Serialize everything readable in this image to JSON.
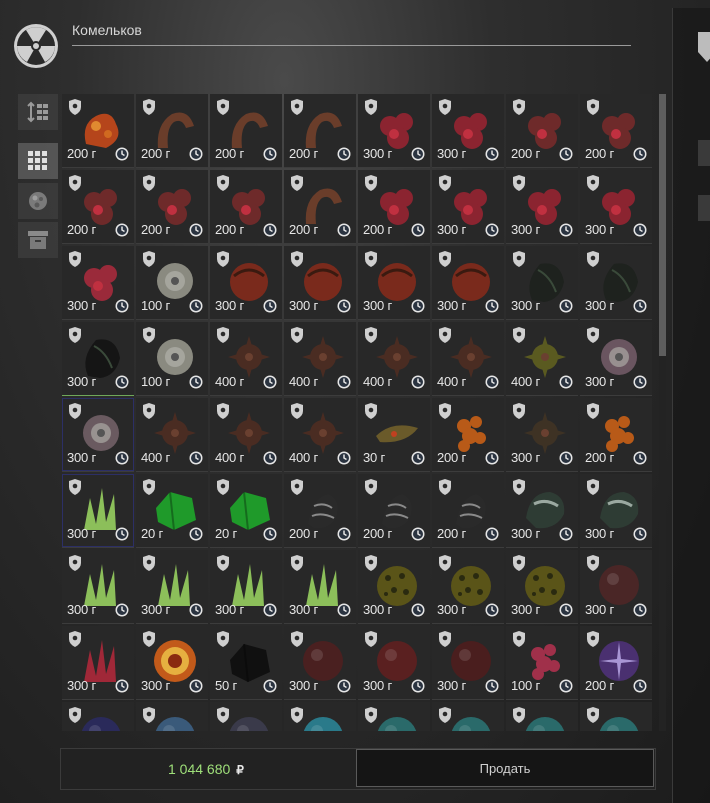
{
  "header": {
    "title": "Комельков"
  },
  "sidebar": {
    "buttons": [
      {
        "name": "sort-button-icon"
      },
      {
        "name": "grid-view-icon",
        "active": true
      },
      {
        "name": "artifact-filter-icon"
      },
      {
        "name": "container-icon"
      }
    ]
  },
  "currency": "г",
  "rows": [
    [
      {
        "p": "200",
        "art": "lava",
        "c": "#b5451b"
      },
      {
        "p": "200",
        "art": "worm",
        "c": "#6a3d2a"
      },
      {
        "p": "200",
        "art": "worm",
        "c": "#6a3d2a"
      },
      {
        "p": "200",
        "art": "worm",
        "c": "#6a3d2a"
      },
      {
        "p": "300",
        "art": "meat",
        "c": "#8b2430"
      },
      {
        "p": "300",
        "art": "meat",
        "c": "#8b2430"
      },
      {
        "p": "200",
        "art": "meat",
        "c": "#6e2a2a"
      },
      {
        "p": "200",
        "art": "meat",
        "c": "#6e2a2a"
      }
    ],
    [
      {
        "p": "200",
        "art": "meat",
        "c": "#6e2a2a"
      },
      {
        "p": "200",
        "art": "meat",
        "c": "#6e2a2a"
      },
      {
        "p": "200",
        "art": "meat",
        "c": "#6e2a2a"
      },
      {
        "p": "200",
        "art": "worm",
        "c": "#6a3d2a"
      },
      {
        "p": "200",
        "art": "meat",
        "c": "#8b2430"
      },
      {
        "p": "300",
        "art": "meat",
        "c": "#8b2430"
      },
      {
        "p": "300",
        "art": "meat",
        "c": "#8b2430"
      },
      {
        "p": "300",
        "art": "meat",
        "c": "#8b2430"
      }
    ],
    [
      {
        "p": "300",
        "art": "meat",
        "c": "#9a2a3a"
      },
      {
        "p": "100",
        "art": "flower",
        "c": "#8a8a80"
      },
      {
        "p": "300",
        "art": "ball",
        "c": "#7a2a1c"
      },
      {
        "p": "300",
        "art": "ball",
        "c": "#7a2a1c"
      },
      {
        "p": "300",
        "art": "ball",
        "c": "#7a2a1c"
      },
      {
        "p": "300",
        "art": "ball",
        "c": "#7a2a1c"
      },
      {
        "p": "300",
        "art": "rock",
        "c": "#1e221e"
      },
      {
        "p": "300",
        "art": "rock",
        "c": "#1e221e"
      }
    ],
    [
      {
        "p": "300",
        "art": "rock",
        "c": "#151515",
        "b": "g"
      },
      {
        "p": "100",
        "art": "flower",
        "c": "#8a8a80"
      },
      {
        "p": "400",
        "art": "spike",
        "c": "#4a2c22"
      },
      {
        "p": "400",
        "art": "spike",
        "c": "#4a2c22"
      },
      {
        "p": "400",
        "art": "spike",
        "c": "#4a2c22"
      },
      {
        "p": "400",
        "art": "spike",
        "c": "#4a2c22"
      },
      {
        "p": "400",
        "art": "spike",
        "c": "#5a5a20"
      },
      {
        "p": "300",
        "art": "flower",
        "c": "#6a5560"
      }
    ],
    [
      {
        "p": "300",
        "art": "flower",
        "c": "#6a5a60",
        "b": "b"
      },
      {
        "p": "400",
        "art": "spike",
        "c": "#4a2c22"
      },
      {
        "p": "400",
        "art": "spike",
        "c": "#4a2c22"
      },
      {
        "p": "400",
        "art": "spike",
        "c": "#4a2c22"
      },
      {
        "p": "30",
        "art": "leaf",
        "c": "#6a5a2a"
      },
      {
        "p": "200",
        "art": "berry",
        "c": "#b85a18"
      },
      {
        "p": "300",
        "art": "spike",
        "c": "#3e3224"
      },
      {
        "p": "200",
        "art": "berry",
        "c": "#b85a18"
      }
    ],
    [
      {
        "p": "300",
        "art": "crystal",
        "c": "#8cbf5a",
        "b": "b"
      },
      {
        "p": "20",
        "art": "gem",
        "c": "#1f9a2a"
      },
      {
        "p": "20",
        "art": "gem",
        "c": "#1f9a2a"
      },
      {
        "p": "200",
        "art": "web",
        "c": "#2a2a2a"
      },
      {
        "p": "200",
        "art": "web",
        "c": "#2a2a2a"
      },
      {
        "p": "200",
        "art": "web",
        "c": "#2a2a2a"
      },
      {
        "p": "300",
        "art": "shell",
        "c": "#2e3c34"
      },
      {
        "p": "300",
        "art": "shell",
        "c": "#2e3c34"
      }
    ],
    [
      {
        "p": "300",
        "art": "crystal",
        "c": "#8cbf5a"
      },
      {
        "p": "300",
        "art": "crystal",
        "c": "#8cbf5a"
      },
      {
        "p": "300",
        "art": "crystal",
        "c": "#8cbf5a"
      },
      {
        "p": "300",
        "art": "crystal",
        "c": "#8cbf5a"
      },
      {
        "p": "300",
        "art": "sponge",
        "c": "#5a5418"
      },
      {
        "p": "300",
        "art": "sponge",
        "c": "#5a5418"
      },
      {
        "p": "300",
        "art": "sponge",
        "c": "#5a5418"
      },
      {
        "p": "300",
        "art": "orb",
        "c": "#4a2626"
      }
    ],
    [
      {
        "p": "300",
        "art": "crystal",
        "c": "#a02838"
      },
      {
        "p": "300",
        "art": "spiral",
        "c": "#c25a1a"
      },
      {
        "p": "50",
        "art": "gem",
        "c": "#101010"
      },
      {
        "p": "300",
        "art": "orb",
        "c": "#4a2020"
      },
      {
        "p": "300",
        "art": "orb",
        "c": "#5a2020"
      },
      {
        "p": "300",
        "art": "orb",
        "c": "#4a1e1e"
      },
      {
        "p": "100",
        "art": "berry",
        "c": "#a0304a"
      },
      {
        "p": "200",
        "art": "burst",
        "c": "#4a3070"
      }
    ],
    [
      {
        "p": "",
        "art": "orb",
        "c": "#2a2a5a"
      },
      {
        "p": "",
        "art": "orb",
        "c": "#3a5a7a"
      },
      {
        "p": "",
        "art": "orb",
        "c": "#3a3a4a"
      },
      {
        "p": "",
        "art": "orb",
        "c": "#2a7a8a"
      },
      {
        "p": "",
        "art": "orb",
        "c": "#2a6a6a"
      },
      {
        "p": "",
        "art": "orb",
        "c": "#2a6a6a"
      },
      {
        "p": "",
        "art": "orb",
        "c": "#2a6a6a"
      },
      {
        "p": "",
        "art": "orb",
        "c": "#2a6a6a"
      }
    ]
  ],
  "footer": {
    "balance": "1 044 680",
    "currency_symbol": "₽",
    "sell_label": "Продать"
  }
}
